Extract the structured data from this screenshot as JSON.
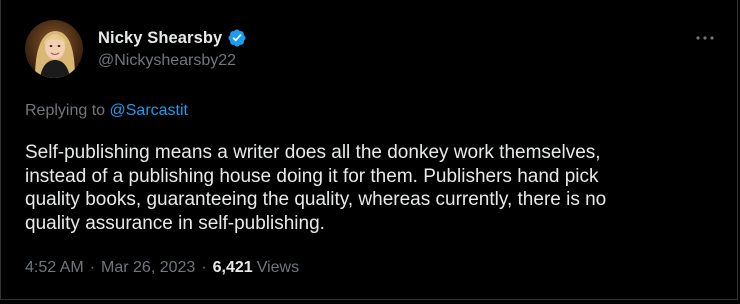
{
  "author": {
    "name": "Nicky Shearsby",
    "handle": "@Nickyshearsby22",
    "verified": true
  },
  "menu_icon": "more-horizontal-icon",
  "reply_context": {
    "prefix": "Replying to",
    "mention": "@Sarcastit"
  },
  "tweet": {
    "text": "Self-publishing means a writer does all the donkey work themselves,\ninstead of a publishing house doing it for them. Publishers hand pick\nquality books, guaranteeing the quality, whereas currently, there is no\nquality assurance in self-publishing."
  },
  "meta": {
    "time": "4:52 AM",
    "separator": "·",
    "date": "Mar 26, 2023",
    "views_count": "6,421",
    "views_label": "Views"
  },
  "colors": {
    "background": "#000000",
    "text_primary": "#e7e9ea",
    "text_secondary": "#71767b",
    "accent": "#1d9bf0"
  }
}
